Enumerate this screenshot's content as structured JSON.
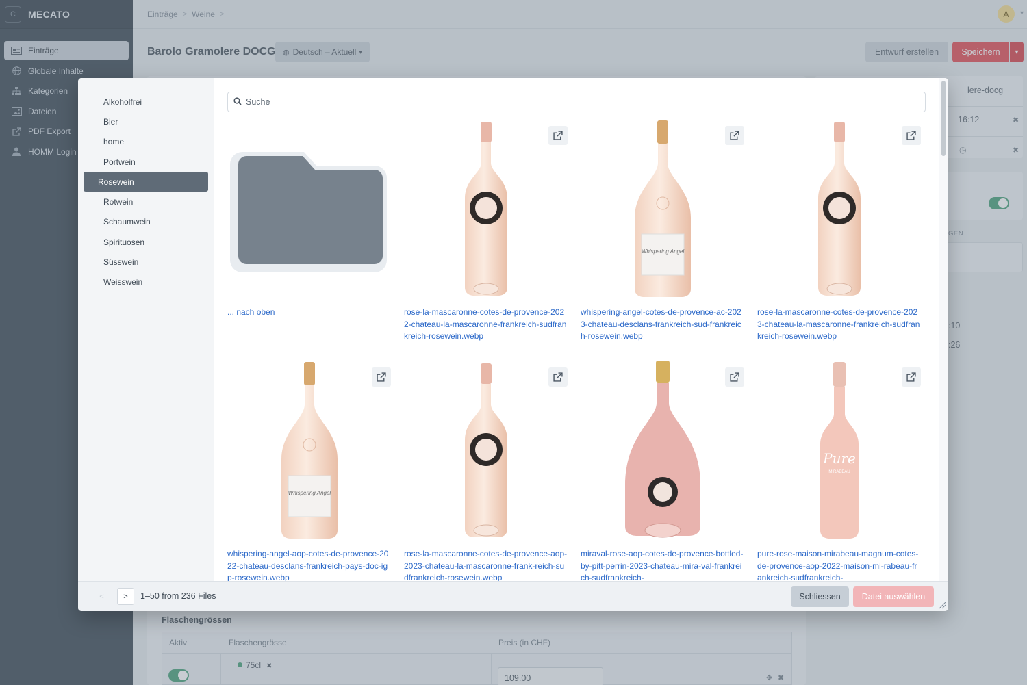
{
  "app": {
    "name": "MECATO",
    "logo_letter": "C"
  },
  "nav": [
    {
      "label": "Einträge",
      "icon": "entries-icon",
      "active": true
    },
    {
      "label": "Globale Inhalte",
      "icon": "globe-icon",
      "active": false
    },
    {
      "label": "Kategorien",
      "icon": "sitemap-icon",
      "active": false
    },
    {
      "label": "Dateien",
      "icon": "image-icon",
      "active": false
    },
    {
      "label": "PDF Export",
      "icon": "external-link-icon",
      "active": false
    },
    {
      "label": "HOMM Login",
      "icon": "user-icon",
      "active": false
    }
  ],
  "breadcrumb": [
    "Einträge",
    "Weine"
  ],
  "user": {
    "avatar_letter": "A"
  },
  "entry": {
    "title": "Barolo Gramolere DOCG",
    "language": "Deutsch – Aktuell"
  },
  "actions": {
    "draft": "Entwurf erstellen",
    "save": "Speichern"
  },
  "right_panel": {
    "slug": "lere-docg",
    "time": "16:12",
    "label": "GEN",
    "time2": ":10",
    "time3": ":26"
  },
  "bottom": {
    "title": "Flaschengrössen",
    "headers": [
      "Aktiv",
      "Flaschengrösse",
      "Preis (in CHF)"
    ],
    "size_tag": "75cl",
    "price": "109.00"
  },
  "modal": {
    "sources": [
      "Alkoholfrei",
      "Bier",
      "home",
      "Portwein",
      "Rosewein",
      "Rotwein",
      "Schaumwein",
      "Spirituosen",
      "Süsswein",
      "Weisswein"
    ],
    "active_source": "Rosewein",
    "search_placeholder": "Suche",
    "folder_up": "... nach oben",
    "files": [
      {
        "name": "rose-la-mascaronne-cotes-de-provence-2022-chateau-la-mascaronne-frankreich-sudfrankreich-rosewein.webp",
        "bottle": "mascaronne"
      },
      {
        "name": "whispering-angel-cotes-de-provence-ac-2023-chateau-desclans-frankreich-sud-frankreich-rosewein.webp",
        "bottle": "angel"
      },
      {
        "name": "rose-la-mascaronne-cotes-de-provence-2023-chateau-la-mascaronne-frankreich-sudfrankreich-rosewein.webp",
        "bottle": "mascaronne"
      },
      {
        "name": "whispering-angel-aop-cotes-de-provence-2022-chateau-desclans-frankreich-pays-doc-igp-rosewein.webp",
        "bottle": "angel"
      },
      {
        "name": "rose-la-mascaronne-cotes-de-provence-aop-2023-chateau-la-mascaronne-frank-reich-sudfrankreich-rosewein.webp",
        "bottle": "mascaronne"
      },
      {
        "name": "miraval-rose-aop-cotes-de-provence-bottled-by-pitt-perrin-2023-chateau-mira-val-frankreich-sudfrankreich-",
        "bottle": "miraval"
      },
      {
        "name": "pure-rose-maison-mirabeau-magnum-cotes-de-provence-aop-2022-maison-mi-rabeau-frankreich-sudfrankreich-",
        "bottle": "pure"
      }
    ],
    "pagination": "1–50 from 236 Files",
    "close": "Schliessen",
    "select": "Datei auswählen"
  },
  "colors": {
    "accent": "#e2444c",
    "link": "#2c69c9",
    "toggle": "#3f9c72",
    "sidebar": "#33404d"
  }
}
